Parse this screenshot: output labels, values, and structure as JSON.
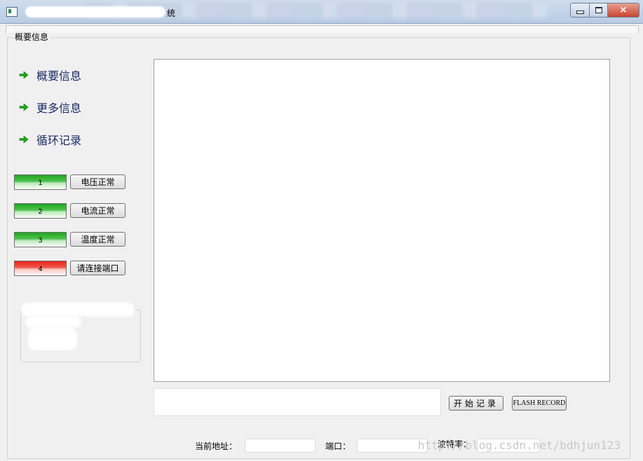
{
  "window": {
    "title_suffix": "统"
  },
  "panel": {
    "legend": "概要信息"
  },
  "nav": [
    {
      "label": "概要信息"
    },
    {
      "label": "更多信息"
    },
    {
      "label": "循环记录"
    }
  ],
  "status": [
    {
      "num": "1",
      "label": "电压正常",
      "color": "#1fa51f"
    },
    {
      "num": "2",
      "label": "电流正常",
      "color": "#1fa51f"
    },
    {
      "num": "3",
      "label": "温度正常",
      "color": "#1fa51f"
    },
    {
      "num": "4",
      "label": "请连接端口",
      "color": "#e8241b"
    }
  ],
  "controls": {
    "start_label": "开始记录",
    "flash_label": "FLASH RECORD"
  },
  "settings": {
    "address_label": "当前地址：",
    "port_label": "端口：",
    "baud_label": "波特率："
  },
  "watermark": "http://blog.csdn.net/bdhjun123",
  "icons": {
    "nav_arrow": "green-right-arrow-icon",
    "window_close": "×"
  }
}
